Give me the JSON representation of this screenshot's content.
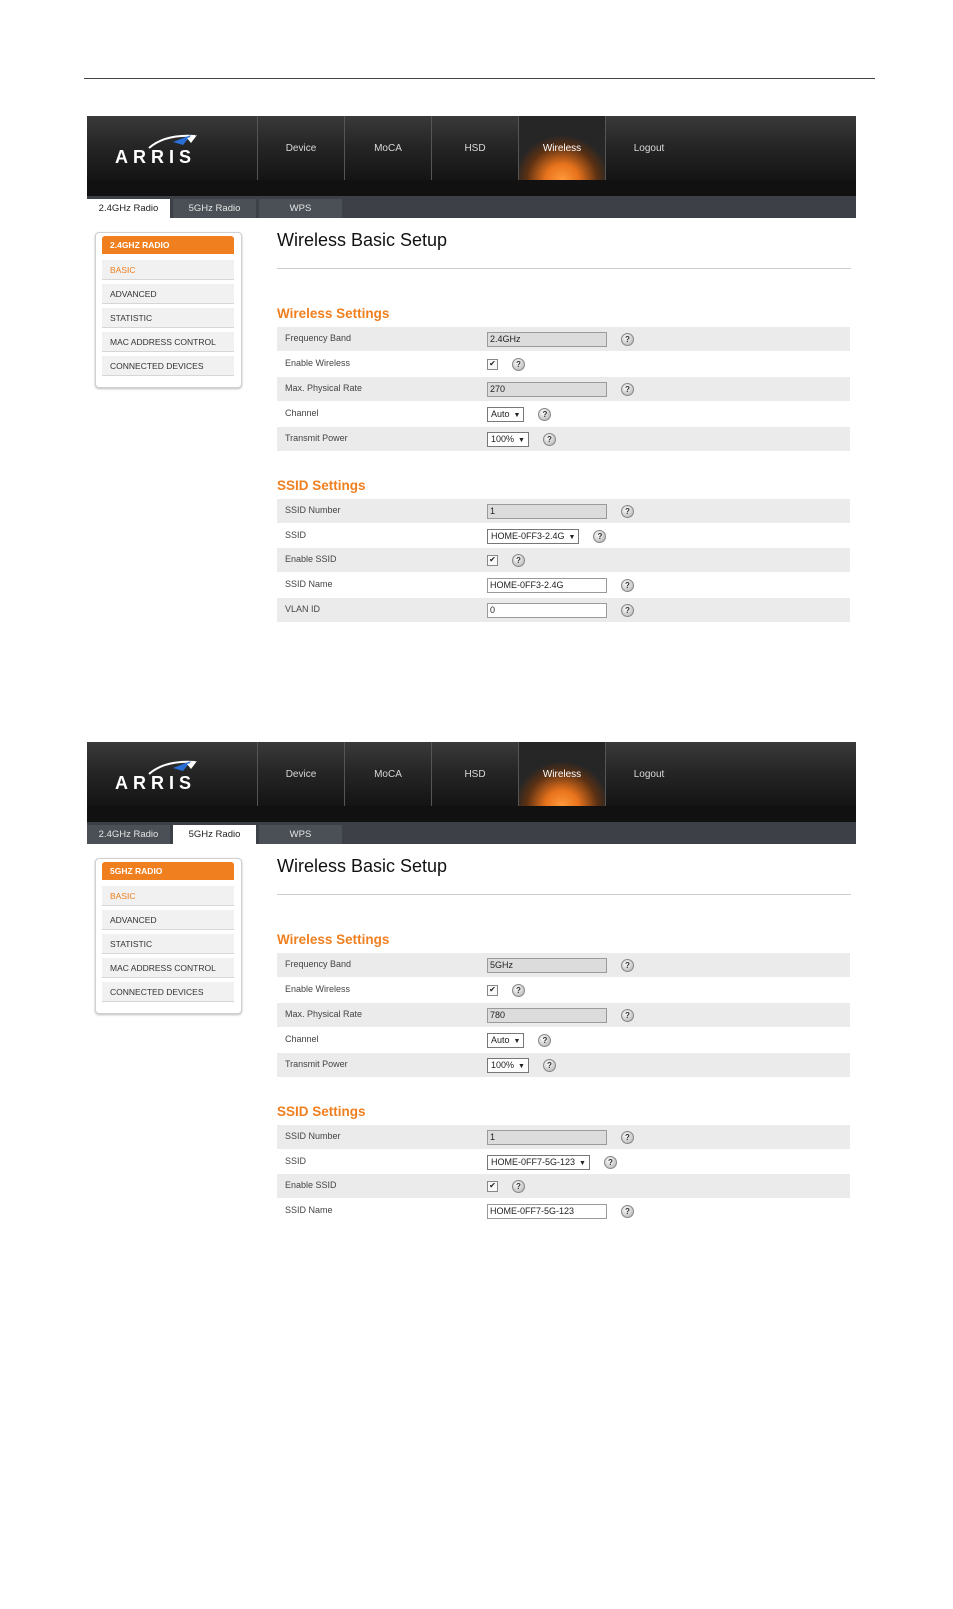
{
  "brand": {
    "logo_text": "ARRIS"
  },
  "nav": [
    "Device",
    "MoCA",
    "HSD",
    "Wireless",
    "Logout"
  ],
  "tabs": [
    "2.4GHz Radio",
    "5GHz Radio",
    "WPS"
  ],
  "sidebar_items": [
    "BASIC",
    "ADVANCED",
    "STATISTIC",
    "MAC ADDRESS CONTROL",
    "CONNECTED DEVICES"
  ],
  "help_glyph": "?",
  "check_glyph": "✔",
  "select_arrow": "▼",
  "labels": {
    "frequency_band": "Frequency Band",
    "enable_wireless": "Enable Wireless",
    "max_rate": "Max. Physical Rate",
    "channel": "Channel",
    "transmit_power": "Transmit Power",
    "ssid_number": "SSID Number",
    "ssid": "SSID",
    "enable_ssid": "Enable SSID",
    "ssid_name": "SSID Name",
    "vlan_id": "VLAN ID"
  },
  "page_title": "Wireless Basic Setup",
  "sections": {
    "wireless": "Wireless Settings",
    "ssid": "SSID Settings"
  },
  "screens": [
    {
      "sidebar_header": "2.4GHZ RADIO",
      "frequency_band": "2.4GHz",
      "max_rate": "270",
      "channel": "Auto",
      "transmit_power": "100%",
      "ssid_number": "1",
      "ssid": "HOME-0FF3-2.4G",
      "ssid_name": "HOME-0FF3-2.4G",
      "vlan_id": "0"
    },
    {
      "sidebar_header": "5GHZ RADIO",
      "frequency_band": "5GHz",
      "max_rate": "780",
      "channel": "Auto",
      "transmit_power": "100%",
      "ssid_number": "1",
      "ssid": "HOME-0FF7-5G-123",
      "ssid_name": "HOME-0FF7-5G-123"
    }
  ]
}
